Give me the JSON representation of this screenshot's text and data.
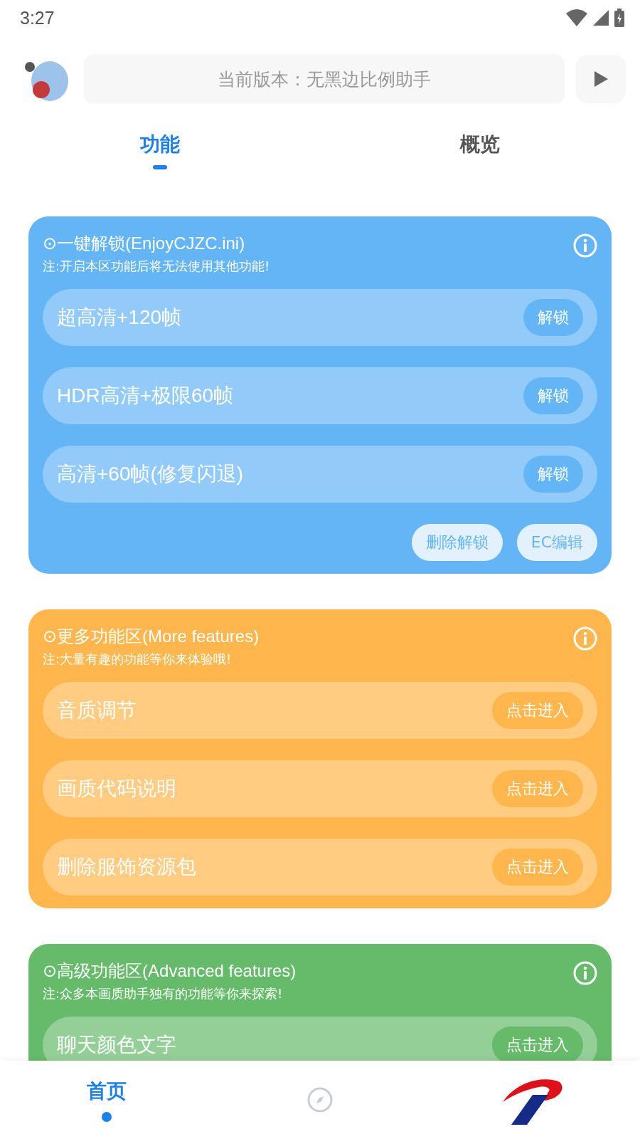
{
  "status_bar": {
    "time": "3:27"
  },
  "header": {
    "version_field": "当前版本：无黑边比例助手"
  },
  "tabs": [
    {
      "label": "功能",
      "selected": true
    },
    {
      "label": "概览",
      "selected": false
    }
  ],
  "cards": [
    {
      "color": "#64b5f6",
      "title": "⊙一键解锁(EnjoyCJZC.ini)",
      "note": "注:开启本区功能后将无法使用其他功能!",
      "rows": [
        {
          "label": "超高清+120帧",
          "button": "解锁"
        },
        {
          "label": "HDR高清+极限60帧",
          "button": "解锁"
        },
        {
          "label": "高清+60帧(修复闪退)",
          "button": "解锁"
        }
      ],
      "footer_buttons": [
        "删除解锁",
        "EC编辑"
      ]
    },
    {
      "color": "#ffb74d",
      "title": "⊙更多功能区(More features)",
      "note": "注:大量有趣的功能等你来体验哦!",
      "rows": [
        {
          "label": "音质调节",
          "button": "点击进入"
        },
        {
          "label": "画质代码说明",
          "button": "点击进入"
        },
        {
          "label": "删除服饰资源包",
          "button": "点击进入"
        }
      ]
    },
    {
      "color": "#66bb6a",
      "title": "⊙高级功能区(Advanced features)",
      "note": "注:众多本画质助手独有的功能等你来探索!",
      "rows": [
        {
          "label": "聊天颜色文字",
          "button": "点击进入"
        }
      ]
    }
  ],
  "bottom_nav": [
    {
      "kind": "text",
      "label": "首页",
      "selected": true
    },
    {
      "kind": "compass",
      "selected": false
    },
    {
      "kind": "logo",
      "selected": false
    }
  ]
}
